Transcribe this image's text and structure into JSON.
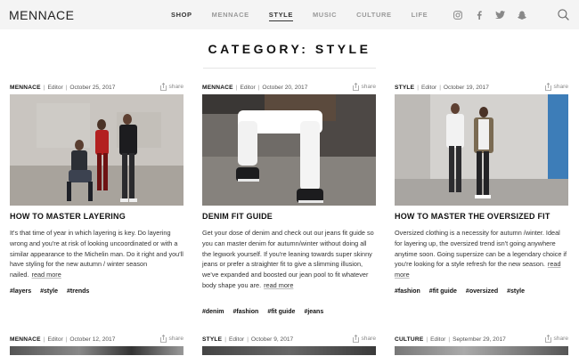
{
  "header": {
    "logo": "MENNACE",
    "nav": [
      "SHOP",
      "MENNACE",
      "STYLE",
      "MUSIC",
      "CULTURE",
      "LIFE"
    ],
    "social_icons": [
      "instagram-icon",
      "facebook-icon",
      "twitter-icon",
      "snapchat-icon"
    ],
    "search_icon": "search-icon"
  },
  "page_title": "CATEGORY: STYLE",
  "share_label": "share",
  "read_more_label": "read more",
  "cards": [
    {
      "category": "MENNACE",
      "author": "Editor",
      "date": "October 25, 2017",
      "title": "HOW TO MASTER LAYERING",
      "excerpt": "It's that time of year in which layering is key. Do layering wrong and you're at risk of looking uncoordinated or with a similar appearance to the Michelin man. Do it right and you'll have styling for the new autumn / winter season nailed.",
      "tags": [
        "#layers",
        "#style",
        "#trends"
      ]
    },
    {
      "category": "MENNACE",
      "author": "Editor",
      "date": "October 20, 2017",
      "title": "DENIM FIT GUIDE",
      "excerpt": "Get your dose of denim and check out our jeans fit guide so you can master denim for autumn/winter without doing all the legwork yourself. If you're leaning towards super skinny jeans or prefer a straighter fit to give a slimming illusion, we've expanded and boosted our jean pool to fit whatever body shape you are.",
      "tags": [
        "#denim",
        "#fashion",
        "#fit guide",
        "#jeans"
      ]
    },
    {
      "category": "STYLE",
      "author": "Editor",
      "date": "October 19, 2017",
      "title": "HOW TO MASTER THE OVERSIZED FIT",
      "excerpt": "Oversized clothing is a necessity for autumn /winter. Ideal for layering up,  the oversized trend isn't going anywhere anytime soon. Going supersize can be a legendary choice if you're looking for a style refresh for the new season.",
      "tags": [
        "#fashion",
        "#fit guide",
        "#oversized",
        "#style"
      ]
    }
  ],
  "next_row": [
    {
      "category": "MENNACE",
      "author": "Editor",
      "date": "October 12, 2017"
    },
    {
      "category": "STYLE",
      "author": "Editor",
      "date": "October 9, 2017"
    },
    {
      "category": "CULTURE",
      "author": "Editor",
      "date": "September 29, 2017"
    }
  ],
  "colors": {
    "header_bg": "#f4f4f4",
    "text": "#222222",
    "muted": "#999999"
  }
}
